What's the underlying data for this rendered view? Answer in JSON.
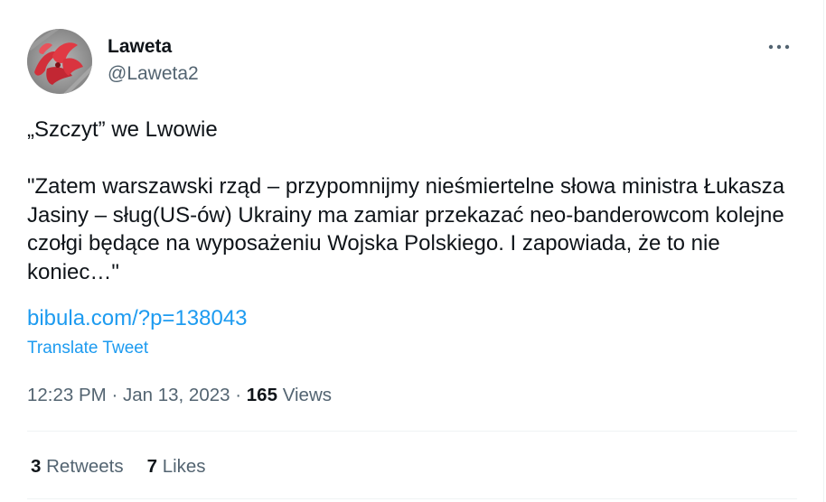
{
  "author": {
    "display_name": "Laweta",
    "handle": "@Laweta2",
    "avatar": "avatar-image"
  },
  "more_icon": "more-dots-icon",
  "tweet": {
    "text": "„Szczyt” we Lwowie\n\n\"Zatem warszawski rząd – przypomnijmy nieśmiertelne słowa ministra Łukasza Jasiny – sług(US-ów) Ukrainy ma zamiar przekazać neo-banderowcom kolejne czołgi będące na wyposażeniu Wojska Polskiego. I zapowiada, że to nie koniec…\"",
    "link": "bibula.com/?p=138043",
    "translate_label": "Translate Tweet"
  },
  "meta": {
    "time": "12:23 PM",
    "separator": "·",
    "date": "Jan 13, 2023",
    "views_count": "165",
    "views_label": "Views"
  },
  "stats": {
    "retweets_count": "3",
    "retweets_label": "Retweets",
    "likes_count": "7",
    "likes_label": "Likes"
  },
  "colors": {
    "text": "#0f1419",
    "secondary": "#536471",
    "link": "#1d9bf0",
    "divider": "#eff3f4"
  }
}
